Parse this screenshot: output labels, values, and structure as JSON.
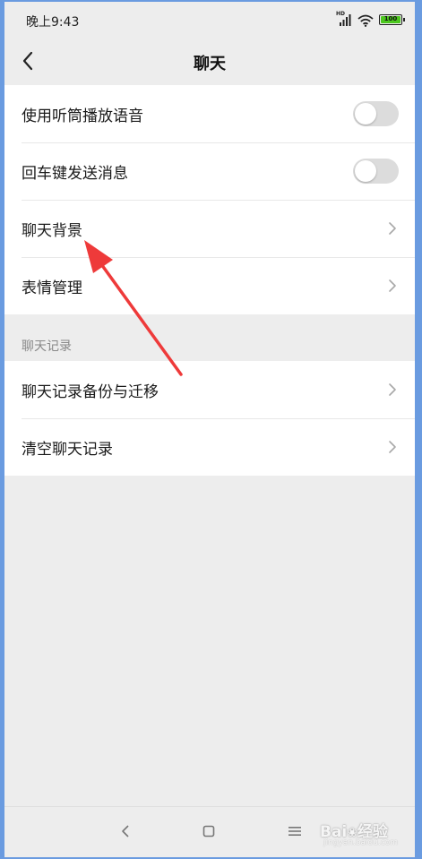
{
  "status_bar": {
    "time": "晚上9:43",
    "network_badge": "HD",
    "battery_level": "100",
    "battery_color": "#4cc81e"
  },
  "header": {
    "title": "聊天",
    "back_icon": "chevron-left-icon"
  },
  "settings_group_1": {
    "items": [
      {
        "label": "使用听筒播放语音",
        "control": "toggle",
        "on": false
      },
      {
        "label": "回车键发送消息",
        "control": "toggle",
        "on": false
      },
      {
        "label": "聊天背景",
        "control": "chevron"
      },
      {
        "label": "表情管理",
        "control": "chevron"
      }
    ]
  },
  "chat_records_section": {
    "title": "聊天记录",
    "items": [
      {
        "label": "聊天记录备份与迁移",
        "control": "chevron"
      },
      {
        "label": "清空聊天记录",
        "control": "chevron"
      }
    ]
  },
  "bottom_nav": {
    "back_icon": "triangle-back-icon",
    "home_icon": "square-home-icon",
    "menu_icon": "menu-lines-icon"
  },
  "watermark": {
    "brand": "Bai",
    "brand_suffix": "经验",
    "url": "jingyan.baidu.com"
  },
  "annotation": {
    "arrow_color": "#ee3a3a",
    "points_to": "聊天背景"
  },
  "colors": {
    "background": "#ededed",
    "card": "#ffffff",
    "toggle_off": "#dcdcdc",
    "frame": "#6a9be0"
  }
}
